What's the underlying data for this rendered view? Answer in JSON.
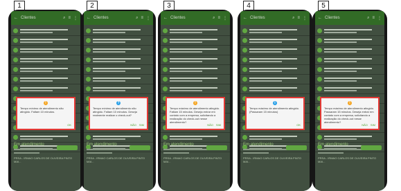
{
  "labels": [
    "1",
    "2",
    "3",
    "4",
    "5"
  ],
  "app": {
    "title": "Clientes",
    "section": "Em atendimento",
    "item_title": "PRSA - IRMAO CARLOS DE OLIVEIRA PINTO MAI...",
    "action_label": "Check-out"
  },
  "phones": [
    {
      "dialog_icon": "!",
      "dialog_kind": "warn",
      "message": "Tempo mínimo de atendimento não atingido. Faltam 10 minutos.",
      "actions": [
        "OK"
      ]
    },
    {
      "dialog_icon": "?",
      "dialog_kind": "info",
      "message": "Tempo mínimo de atendimento não atingido. Faltam 10 minutos. Deseja realmente realizar o check-out?",
      "actions": [
        "NÃO",
        "SIM"
      ]
    },
    {
      "dialog_icon": "!",
      "dialog_kind": "warn",
      "message": "Tempo máximo de atendimento atingido. Faltam 15 minutos. Deseja entrar em contato com a empresa, solicitando a realização do check-out nesse atendimento?",
      "actions": [
        "NÃO",
        "SIM"
      ]
    },
    {
      "dialog_icon": "i",
      "dialog_kind": "info",
      "message": "Tempo máximo de atendimento atingido. (Passaram 15 minutos)",
      "actions": [
        "OK"
      ]
    },
    {
      "dialog_icon": "!",
      "dialog_kind": "warn",
      "message": "Tempo máximo de atendimento atingido. Passaram 15 minutos. Deseja entrar em contato com a empresa, solicitando a realização do check-out nesse atendimento?",
      "actions": [
        "NÃO",
        "SIM"
      ]
    }
  ],
  "icons": {
    "back": "back-arrow-icon",
    "search": "search-icon",
    "filter": "filter-icon",
    "menu": "more-vert-icon"
  }
}
